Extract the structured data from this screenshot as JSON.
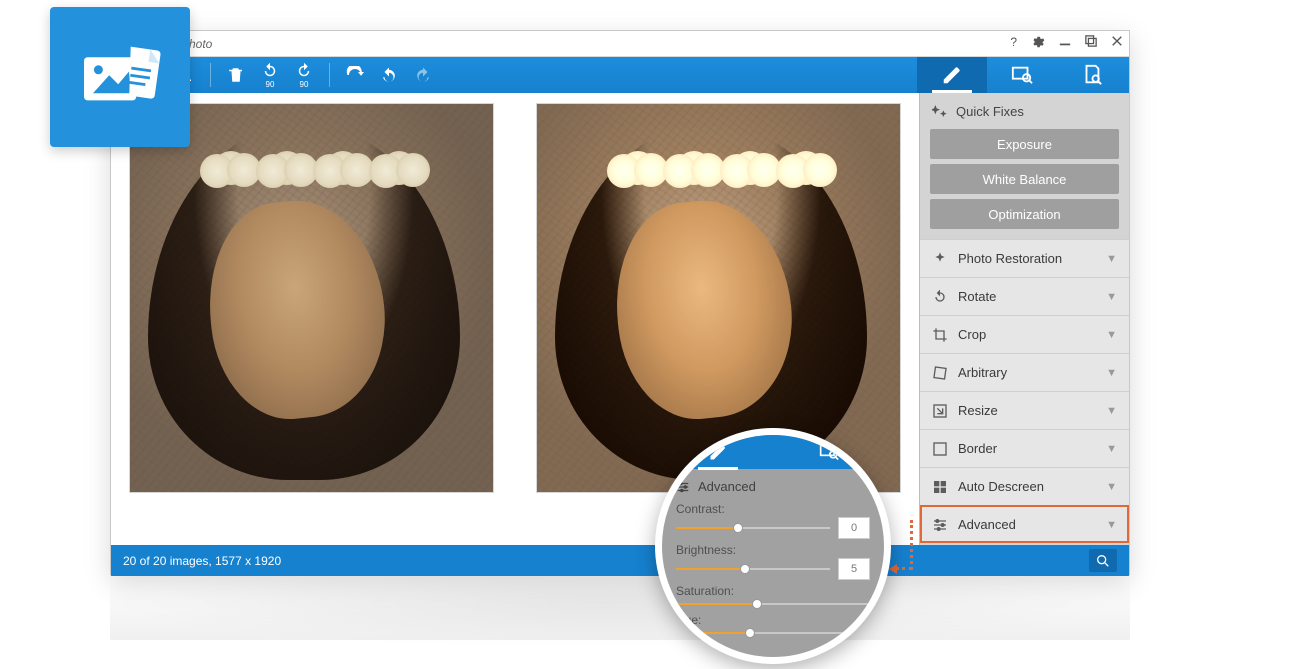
{
  "titlebar": {
    "app_name_suffix": "hoto"
  },
  "toolbar": {
    "rotate_left_label": "90",
    "rotate_right_label": "90"
  },
  "quick_fixes": {
    "title": "Quick Fixes",
    "buttons": [
      "Exposure",
      "White Balance",
      "Optimization"
    ]
  },
  "accordion": [
    {
      "label": "Photo Restoration",
      "icon": "restore"
    },
    {
      "label": "Rotate",
      "icon": "rotate"
    },
    {
      "label": "Crop",
      "icon": "crop"
    },
    {
      "label": "Arbitrary",
      "icon": "arbitrary"
    },
    {
      "label": "Resize",
      "icon": "resize"
    },
    {
      "label": "Border",
      "icon": "border"
    },
    {
      "label": "Auto Descreen",
      "icon": "descreen"
    },
    {
      "label": "Advanced",
      "icon": "sliders",
      "highlight": true
    }
  ],
  "status": {
    "text": "20 of 20 images, 1577 x 1920"
  },
  "zoom": {
    "section_title": "Advanced",
    "rows": [
      {
        "label": "Contrast:",
        "value": "0",
        "fill": 40
      },
      {
        "label": "Brightness:",
        "value": "5",
        "fill": 45
      },
      {
        "label": "Saturation:",
        "value": "",
        "fill": 42,
        "novalue": true
      },
      {
        "label": "Hue:",
        "value": "",
        "fill": 38,
        "novalue": true
      }
    ]
  }
}
